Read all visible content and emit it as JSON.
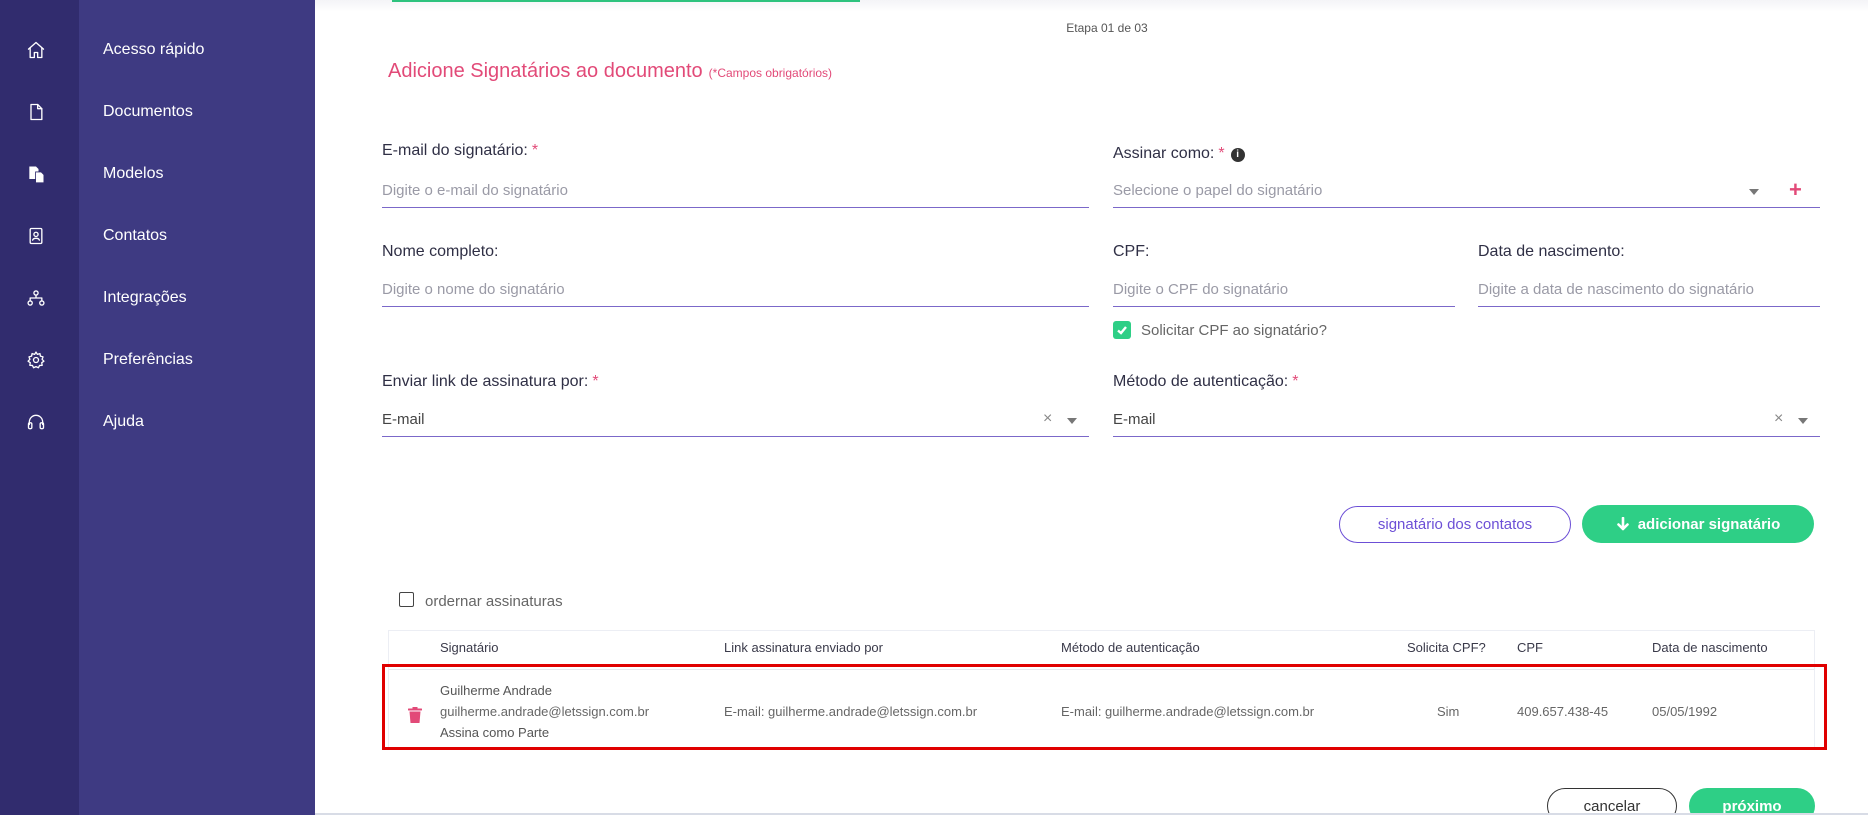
{
  "sidebar": {
    "items": [
      {
        "label": "Acesso rápido",
        "icon": "home-icon"
      },
      {
        "label": "Documentos",
        "icon": "document-icon"
      },
      {
        "label": "Modelos",
        "icon": "templates-icon"
      },
      {
        "label": "Contatos",
        "icon": "contacts-icon"
      },
      {
        "label": "Integrações",
        "icon": "integrations-icon"
      },
      {
        "label": "Preferências",
        "icon": "gear-icon"
      },
      {
        "label": "Ajuda",
        "icon": "headset-icon"
      }
    ]
  },
  "header": {
    "stage": "Etapa 01 de 03",
    "title": "Adicione Signatários ao documento",
    "required_note": "(*Campos obrigatórios)"
  },
  "form": {
    "required_mark": "*",
    "email": {
      "label": "E-mail do signatário:",
      "placeholder": "Digite o e-mail do signatário",
      "value": ""
    },
    "role": {
      "label": "Assinar como:",
      "placeholder": "Selecione o papel do signatário"
    },
    "name": {
      "label": "Nome completo:",
      "placeholder": "Digite o nome do signatário",
      "value": ""
    },
    "cpf": {
      "label": "CPF:",
      "placeholder": "Digite o CPF do signatário",
      "value": ""
    },
    "birth": {
      "label": "Data de nascimento:",
      "placeholder": "Digite a data de nascimento do signatário",
      "value": ""
    },
    "request_cpf": {
      "label": "Solicitar CPF ao signatário?",
      "checked": true
    },
    "send_link": {
      "label": "Enviar link de assinatura por:",
      "value": "E-mail"
    },
    "auth_method": {
      "label": "Método de autenticação:",
      "value": "E-mail"
    }
  },
  "actions": {
    "contacts_button": "signatário dos contatos",
    "add_button": "adicionar signatário",
    "order_label": "ordernar assinaturas",
    "cancel_button": "cancelar",
    "next_button": "próximo"
  },
  "table": {
    "headers": {
      "signer": "Signatário",
      "link": "Link assinatura enviado por",
      "auth": "Método de autenticação",
      "request_cpf": "Solicita CPF?",
      "cpf": "CPF",
      "birth": "Data de nascimento"
    },
    "rows": [
      {
        "name": "Guilherme Andrade",
        "email": "guilherme.andrade@letssign.com.br",
        "role": "Assina como Parte",
        "link": "E-mail: guilherme.andrade@letssign.com.br",
        "auth": "E-mail: guilherme.andrade@letssign.com.br",
        "request_cpf": "Sim",
        "cpf": "409.657.438-45",
        "birth": "05/05/1992"
      }
    ]
  },
  "colors": {
    "rail": "#312c6e",
    "sidebar": "#3e3a82",
    "accent_pink": "#e24a78",
    "accent_green": "#2ecf86",
    "accent_purple": "#6c4fd6",
    "highlight": "#e00000"
  }
}
